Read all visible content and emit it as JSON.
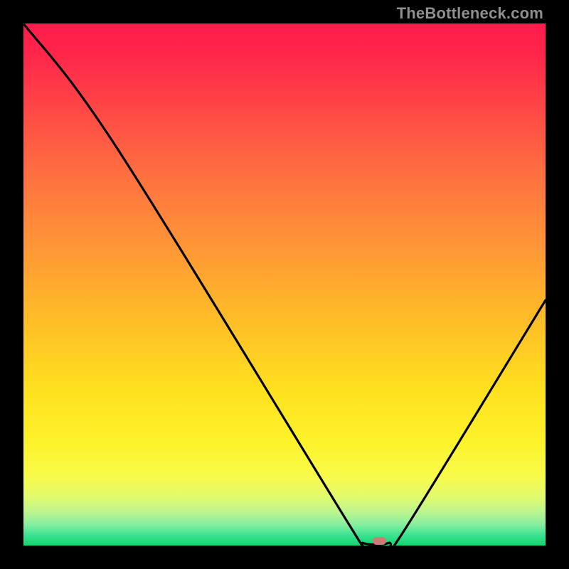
{
  "watermark": "TheBottleneck.com",
  "chart_data": {
    "type": "line",
    "title": "",
    "xlabel": "",
    "ylabel": "",
    "xlim": [
      0,
      100
    ],
    "ylim": [
      0,
      100
    ],
    "series": [
      {
        "name": "curve",
        "points": [
          {
            "x": 0,
            "y": 100
          },
          {
            "x": 18,
            "y": 76
          },
          {
            "x": 63,
            "y": 3
          },
          {
            "x": 65,
            "y": 0.5
          },
          {
            "x": 70,
            "y": 0.5
          },
          {
            "x": 73,
            "y": 3
          },
          {
            "x": 100,
            "y": 47
          }
        ]
      }
    ],
    "marker": {
      "x": 68.2,
      "y": 0.9,
      "w": 2.5,
      "h": 1.5
    },
    "gradient_stops": [
      {
        "offset": 0.0,
        "color": "#ff1c4c"
      },
      {
        "offset": 0.06,
        "color": "#ff264a"
      },
      {
        "offset": 0.15,
        "color": "#ff4346"
      },
      {
        "offset": 0.28,
        "color": "#ff6d41"
      },
      {
        "offset": 0.42,
        "color": "#ff9437"
      },
      {
        "offset": 0.56,
        "color": "#ffbb28"
      },
      {
        "offset": 0.7,
        "color": "#ffe01f"
      },
      {
        "offset": 0.8,
        "color": "#fcf22a"
      },
      {
        "offset": 0.865,
        "color": "#f9fb4a"
      },
      {
        "offset": 0.905,
        "color": "#e4fa6b"
      },
      {
        "offset": 0.935,
        "color": "#bdf68e"
      },
      {
        "offset": 0.96,
        "color": "#86eea0"
      },
      {
        "offset": 0.98,
        "color": "#3de292"
      },
      {
        "offset": 1.0,
        "color": "#09d86f"
      }
    ]
  }
}
